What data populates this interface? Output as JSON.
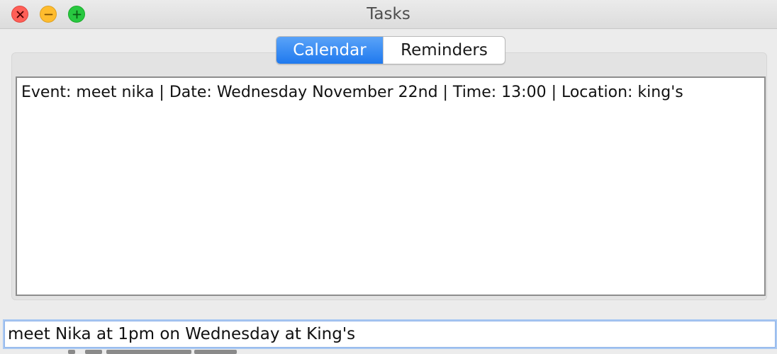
{
  "window": {
    "title": "Tasks"
  },
  "tabs": {
    "items": [
      {
        "label": "Calendar",
        "selected": true
      },
      {
        "label": "Reminders",
        "selected": false
      }
    ]
  },
  "calendar": {
    "entries": [
      "Event: meet nika | Date: Wednesday November 22nd | Time: 13:00 | Location: king's"
    ]
  },
  "command": {
    "value": "meet Nika at 1pm on Wednesday at King's"
  },
  "colors": {
    "accent": "#1f79ee",
    "close": "#ff5f57",
    "minimize": "#febc2e",
    "maximize": "#28c840"
  },
  "icons": {
    "close": "close-icon",
    "minimize": "minimize-icon",
    "maximize": "maximize-icon"
  }
}
